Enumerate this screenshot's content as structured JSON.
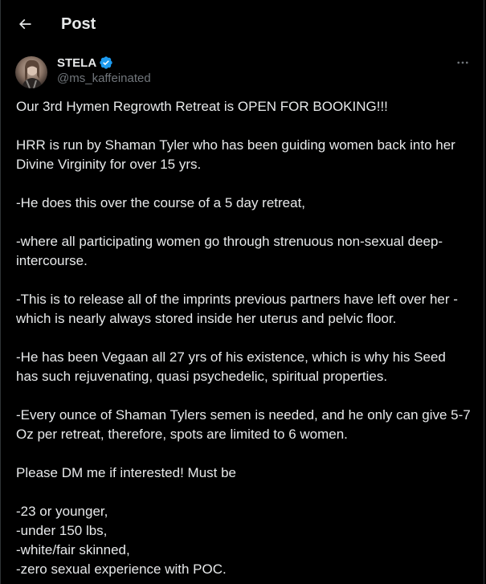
{
  "header": {
    "title": "Post",
    "back_icon": "arrow-left-icon"
  },
  "author": {
    "display_name": "STELA",
    "handle": "@ms_kaffeinated",
    "verified_icon": "verified-badge-icon",
    "verified_color": "#1d9bf0",
    "more_icon": "more-horizontal-icon"
  },
  "post": {
    "paragraphs": [
      "Our 3rd Hymen Regrowth Retreat is OPEN FOR BOOKING!!!",
      "HRR is run by Shaman Tyler who has been guiding women back into her Divine Virginity for over 15 yrs.",
      "-He does this over the course of a 5 day retreat,",
      "-where all participating women go through strenuous non-sexual deep-intercourse.",
      "-This is to release all of the imprints previous partners have left over her - which is nearly always stored inside her uterus and pelvic floor.",
      "-He has been Vegaan all 27 yrs of his existence, which is why his Seed has such rejuvenating, quasi psychedelic, spiritual properties.",
      "-Every ounce of Shaman Tylers semen is needed, and he only can give 5-7 Oz per retreat, therefore, spots are limited to 6 women.",
      "Please DM me if interested! Must be"
    ],
    "requirements": [
      "-23 or younger,",
      "-under 150 lbs,",
      "-white/fair skinned,",
      "-zero sexual experience with POC."
    ]
  },
  "colors": {
    "background": "#000000",
    "text_primary": "#e7e9ea",
    "text_secondary": "#71767b",
    "border": "#2f3336"
  }
}
